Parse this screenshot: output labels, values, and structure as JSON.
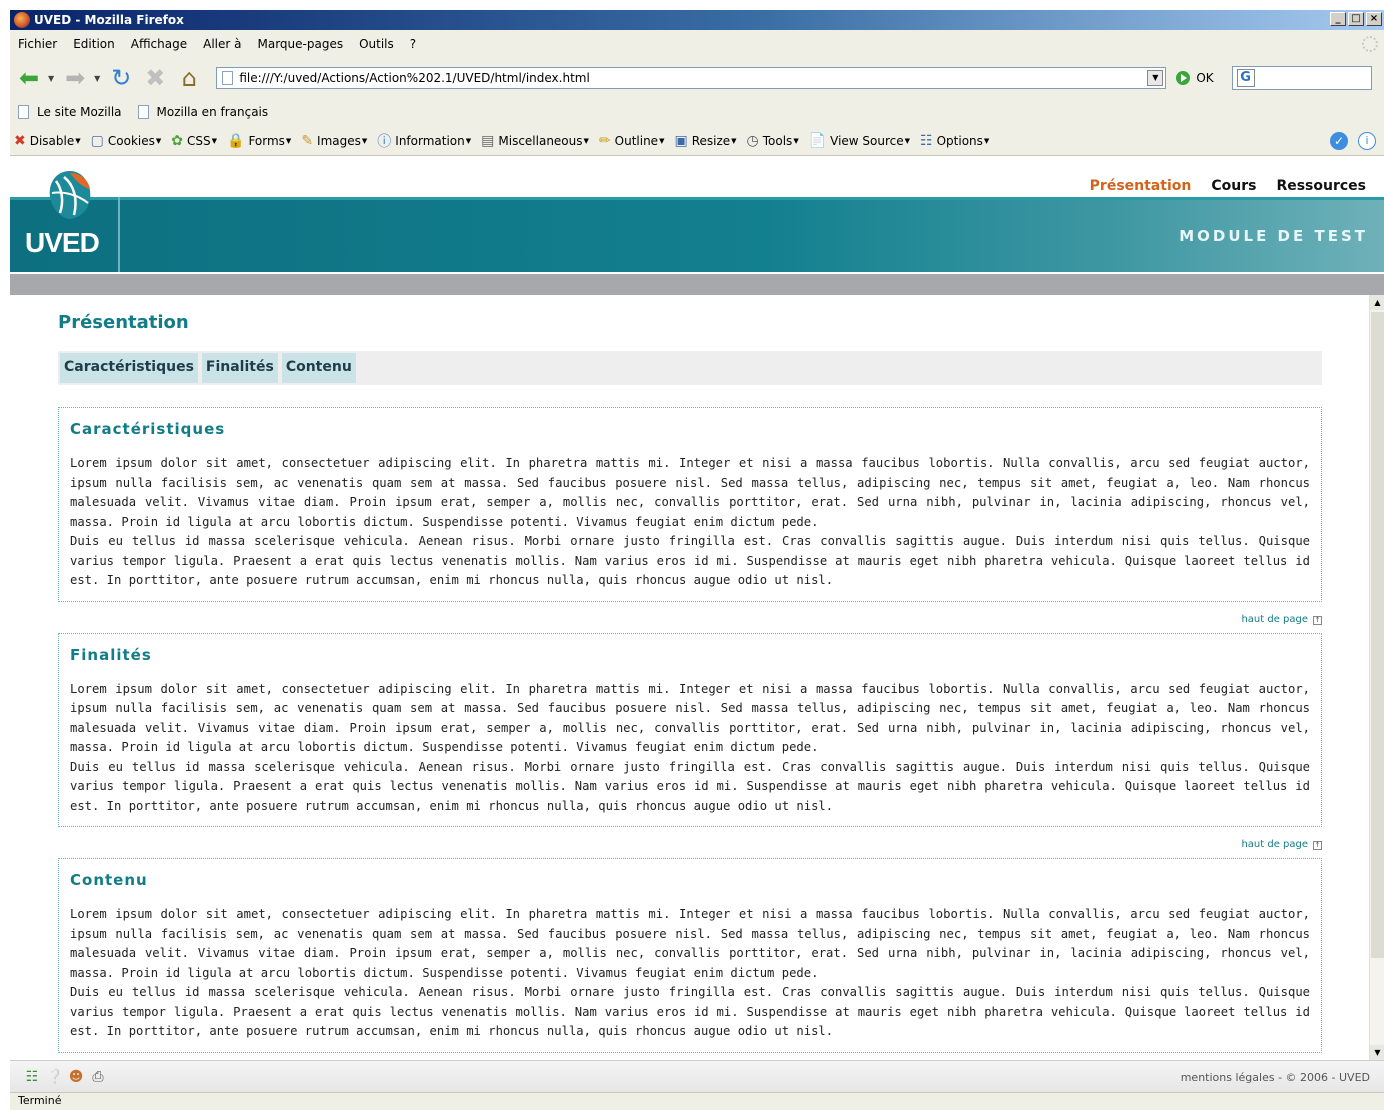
{
  "window": {
    "title": "UVED - Mozilla Firefox",
    "controls": [
      "_",
      "×",
      "×"
    ]
  },
  "menubar": [
    "Fichier",
    "Edition",
    "Affichage",
    "Aller à",
    "Marque-pages",
    "Outils",
    "?"
  ],
  "navbar": {
    "url": "file:///Y:/uved/Actions/Action%202.1/UVED/html/index.html",
    "go_label": "OK"
  },
  "bookmarks": [
    "Le site Mozilla",
    "Mozilla en français"
  ],
  "devbar": [
    "Disable",
    "Cookies",
    "CSS",
    "Forms",
    "Images",
    "Information",
    "Miscellaneous",
    "Outline",
    "Resize",
    "Tools",
    "View Source",
    "Options"
  ],
  "site": {
    "logo_text": "UVED",
    "module_title": "MODULE DE TEST",
    "nav": [
      {
        "label": "Présentation",
        "active": true
      },
      {
        "label": "Cours",
        "active": false
      },
      {
        "label": "Ressources",
        "active": false
      }
    ],
    "colors": {
      "accent": "#127c87",
      "active_nav": "#d3621a",
      "band": "#0d6f80"
    }
  },
  "content": {
    "page_title": "Présentation",
    "tabs": [
      "Caractéristiques",
      "Finalités",
      "Contenu"
    ],
    "top_link": "haut de page",
    "sections": [
      {
        "title": "Caractéristiques",
        "p1": "Lorem ipsum dolor sit amet, consectetuer adipiscing elit. In pharetra mattis mi. Integer et nisi a massa faucibus lobortis. Nulla convallis, arcu sed feugiat auctor, ipsum nulla facilisis sem, ac venenatis quam sem at massa. Sed faucibus posuere nisl. Sed massa tellus, adipiscing nec, tempus sit amet, feugiat a, leo. Nam rhoncus malesuada velit. Vivamus vitae diam. Proin ipsum erat, semper a, mollis nec, convallis porttitor, erat. Sed urna nibh, pulvinar in, lacinia adipiscing, rhoncus vel, massa. Proin id ligula at arcu lobortis dictum. Suspendisse potenti. Vivamus feugiat enim dictum pede.",
        "p2": "Duis eu tellus id massa scelerisque vehicula. Aenean risus. Morbi ornare justo fringilla est. Cras convallis sagittis augue. Duis interdum nisi quis tellus. Quisque varius tempor ligula. Praesent a erat quis lectus venenatis mollis. Nam varius eros id mi. Suspendisse at mauris eget nibh pharetra vehicula. Quisque laoreet tellus id est. In porttitor, ante posuere rutrum accumsan, enim mi rhoncus nulla, quis rhoncus augue odio ut nisl."
      },
      {
        "title": "Finalités",
        "p1": "Lorem ipsum dolor sit amet, consectetuer adipiscing elit. In pharetra mattis mi. Integer et nisi a massa faucibus lobortis. Nulla convallis, arcu sed feugiat auctor, ipsum nulla facilisis sem, ac venenatis quam sem at massa. Sed faucibus posuere nisl. Sed massa tellus, adipiscing nec, tempus sit amet, feugiat a, leo. Nam rhoncus malesuada velit. Vivamus vitae diam. Proin ipsum erat, semper a, mollis nec, convallis porttitor, erat. Sed urna nibh, pulvinar in, lacinia adipiscing, rhoncus vel, massa. Proin id ligula at arcu lobortis dictum. Suspendisse potenti. Vivamus feugiat enim dictum pede.",
        "p2": "Duis eu tellus id massa scelerisque vehicula. Aenean risus. Morbi ornare justo fringilla est. Cras convallis sagittis augue. Duis interdum nisi quis tellus. Quisque varius tempor ligula. Praesent a erat quis lectus venenatis mollis. Nam varius eros id mi. Suspendisse at mauris eget nibh pharetra vehicula. Quisque laoreet tellus id est. In porttitor, ante posuere rutrum accumsan, enim mi rhoncus nulla, quis rhoncus augue odio ut nisl."
      },
      {
        "title": "Contenu",
        "p1": "Lorem ipsum dolor sit amet, consectetuer adipiscing elit. In pharetra mattis mi. Integer et nisi a massa faucibus lobortis. Nulla convallis, arcu sed feugiat auctor, ipsum nulla facilisis sem, ac venenatis quam sem at massa. Sed faucibus posuere nisl. Sed massa tellus, adipiscing nec, tempus sit amet, feugiat a, leo. Nam rhoncus malesuada velit. Vivamus vitae diam. Proin ipsum erat, semper a, mollis nec, convallis porttitor, erat. Sed urna nibh, pulvinar in, lacinia adipiscing, rhoncus vel, massa. Proin id ligula at arcu lobortis dictum. Suspendisse potenti. Vivamus feugiat enim dictum pede.",
        "p2": "Duis eu tellus id massa scelerisque vehicula. Aenean risus. Morbi ornare justo fringilla est. Cras convallis sagittis augue. Duis interdum nisi quis tellus. Quisque varius tempor ligula. Praesent a erat quis lectus venenatis mollis. Nam varius eros id mi. Suspendisse at mauris eget nibh pharetra vehicula. Quisque laoreet tellus id est. In porttitor, ante posuere rutrum accumsan, enim mi rhoncus nulla, quis rhoncus augue odio ut nisl."
      }
    ]
  },
  "footer": {
    "icons": [
      "sitemap-icon",
      "help-icon",
      "user-icon",
      "print-icon"
    ],
    "legal": "mentions légales - © 2006 - UVED"
  },
  "status": "Terminé"
}
